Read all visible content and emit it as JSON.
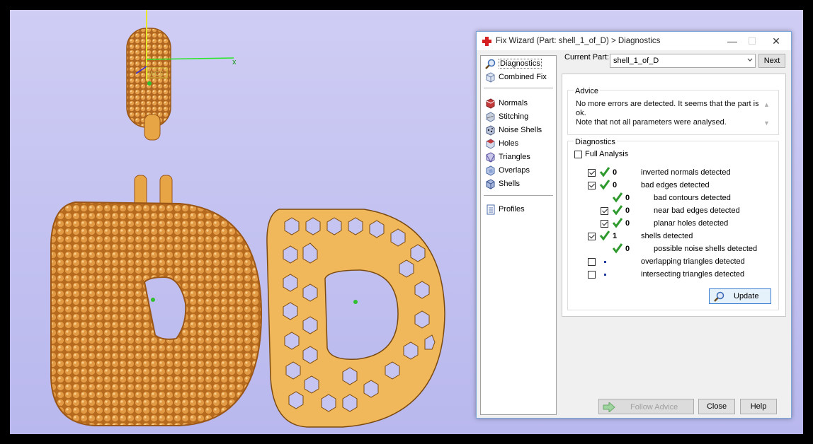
{
  "viewport": {
    "axis_label_x": "x",
    "axis_label_wcs": "WCS"
  },
  "dialog": {
    "title": "Fix Wizard (Part: shell_1_of_D) > Diagnostics",
    "title_icon": "red-cross-icon",
    "minimize_symbol": "—",
    "maximize_symbol": "☐",
    "close_symbol": "✕"
  },
  "nav": {
    "items": [
      {
        "label": "Diagnostics",
        "icon": "magnifier-icon"
      },
      {
        "label": "Combined Fix",
        "icon": "cube-icon"
      },
      {
        "label": "Normals",
        "icon": "normals-icon"
      },
      {
        "label": "Stitching",
        "icon": "stitching-icon"
      },
      {
        "label": "Noise Shells",
        "icon": "noise-shells-icon"
      },
      {
        "label": "Holes",
        "icon": "holes-icon"
      },
      {
        "label": "Triangles",
        "icon": "triangles-icon"
      },
      {
        "label": "Overlaps",
        "icon": "overlaps-icon"
      },
      {
        "label": "Shells",
        "icon": "shells-icon"
      },
      {
        "label": "Profiles",
        "icon": "document-icon"
      }
    ]
  },
  "current_part": {
    "label": "Current Part:",
    "value": "shell_1_of_D",
    "next_label": "Next"
  },
  "advice": {
    "title": "Advice",
    "line1": "No more errors are detected. It seems that the part is ok.",
    "line2": "Note that not all parameters were analysed."
  },
  "diagnostics": {
    "title": "Diagnostics",
    "full_analysis_label": "Full Analysis",
    "rows": [
      {
        "count": "0",
        "label": "inverted normals detected"
      },
      {
        "count": "0",
        "label": "bad edges detected"
      },
      {
        "count": "0",
        "label": "bad contours detected"
      },
      {
        "count": "0",
        "label": "near bad edges detected"
      },
      {
        "count": "0",
        "label": "planar holes detected"
      },
      {
        "count": "1",
        "label": "shells detected"
      },
      {
        "count": "0",
        "label": "possible noise shells detected"
      },
      {
        "count": "",
        "label": "overlapping triangles detected"
      },
      {
        "count": "",
        "label": "intersecting triangles detected"
      }
    ],
    "update_label": "Update"
  },
  "footer": {
    "follow_advice_label": "Follow Advice",
    "close_label": "Close",
    "help_label": "Help"
  },
  "colors": {
    "accent_green": "#2e9a2e",
    "gold": "#e8a545",
    "viewport_bg": "#c6c5f1"
  }
}
